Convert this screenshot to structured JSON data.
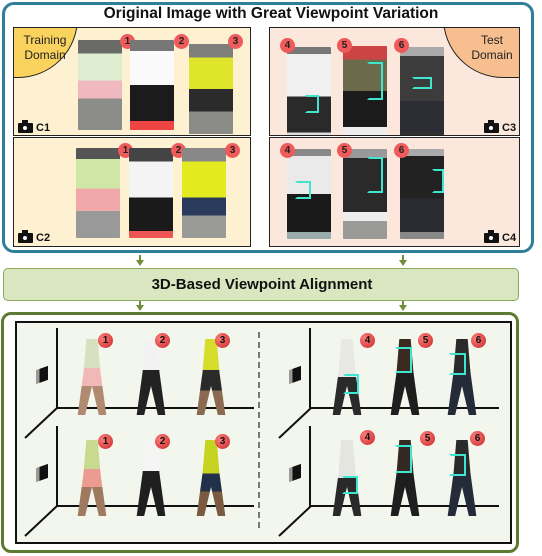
{
  "top_section": {
    "title": "Original Image with Great Viewpoint Variation",
    "training_domain_label_line1": "Training",
    "training_domain_label_line2": "Domain",
    "test_domain_label_line1": "Test",
    "test_domain_label_line2": "Domain",
    "panels": [
      {
        "camera": "C1",
        "domain": "training",
        "ids": [
          "1",
          "2",
          "3"
        ]
      },
      {
        "camera": "C2",
        "domain": "training",
        "ids": [
          "1",
          "2",
          "3"
        ]
      },
      {
        "camera": "C3",
        "domain": "test",
        "ids": [
          "4",
          "5",
          "6"
        ]
      },
      {
        "camera": "C4",
        "domain": "test",
        "ids": [
          "4",
          "5",
          "6"
        ]
      }
    ]
  },
  "middle": {
    "label": "3D-Based Viewpoint Alignment"
  },
  "bottom_section": {
    "rows": [
      {
        "camera_icon": "camera-1-icon",
        "left_ids": [
          "1",
          "2",
          "3"
        ],
        "right_ids": [
          "4",
          "5",
          "6"
        ]
      },
      {
        "camera_icon": "camera-2-icon",
        "left_ids": [
          "1",
          "2",
          "3"
        ],
        "right_ids": [
          "4",
          "5",
          "6"
        ]
      }
    ]
  },
  "colors": {
    "top_border": "#2f7f99",
    "training_bg": "#fdf1d1",
    "test_bg": "#fbe7dc",
    "training_tag": "#f9d35e",
    "test_tag": "#f7bf8f",
    "badge": "#ef5a5a",
    "highlight": "#3fe6cf",
    "align_bg": "#d9e6c0",
    "bottom_border": "#5d7a33"
  }
}
